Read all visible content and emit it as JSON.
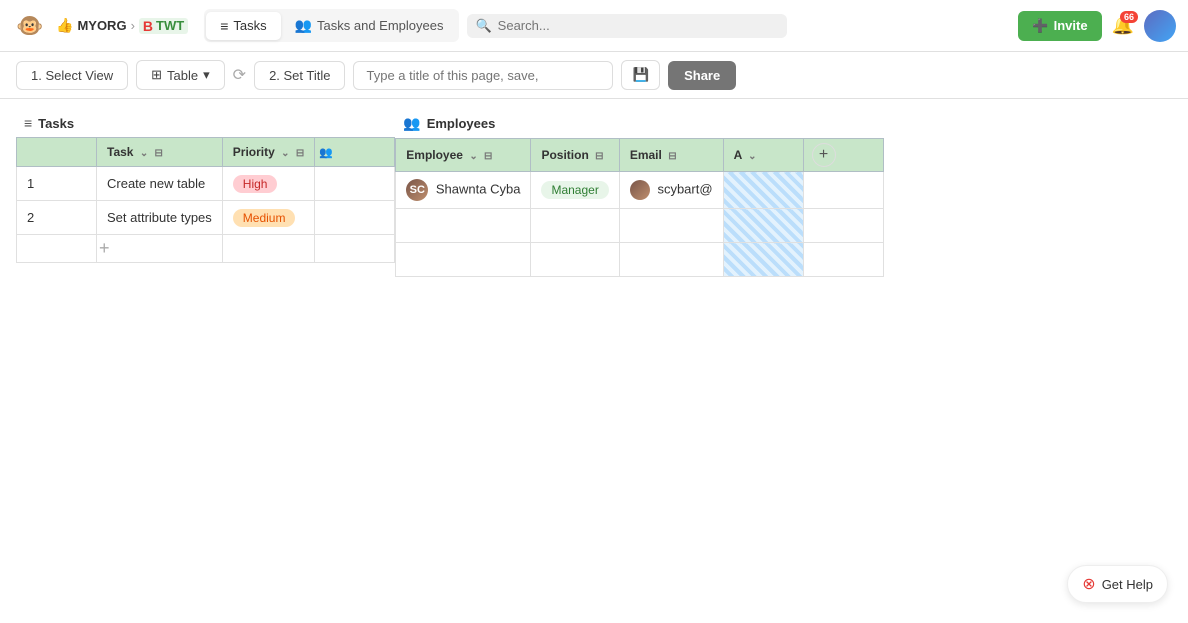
{
  "navbar": {
    "logo": "🐵",
    "org_name": "MYORG",
    "arrow": "›",
    "twt_label": "TWT",
    "tab_tasks": "Tasks",
    "tab_tasks_employees": "Tasks and Employees",
    "search_placeholder": "Search...",
    "invite_label": "Invite",
    "notif_count": "66"
  },
  "toolbar": {
    "step1_label": "1. Select View",
    "table_label": "Table",
    "step2_label": "2. Set Title",
    "title_placeholder": "Type a title of this page, save,",
    "share_label": "Share"
  },
  "tasks_section": {
    "header_icon": "≡",
    "header_label": "Tasks",
    "col_task": "Task",
    "col_priority": "Priority",
    "rows": [
      {
        "num": "1",
        "task": "Create new table",
        "priority": "High",
        "priority_type": "high"
      },
      {
        "num": "2",
        "task": "Set attribute types",
        "priority": "Medium",
        "priority_type": "medium"
      }
    ]
  },
  "employees_section": {
    "header_icon": "👥",
    "header_label": "Employees",
    "col_employee": "Employee",
    "col_position": "Position",
    "col_email": "Email",
    "col_a": "A",
    "rows": [
      {
        "employee": "Shawnta Cyba",
        "position": "Manager",
        "email": "scybart@",
        "avatar_initials": "SC"
      }
    ]
  },
  "get_help": {
    "label": "Get Help"
  }
}
